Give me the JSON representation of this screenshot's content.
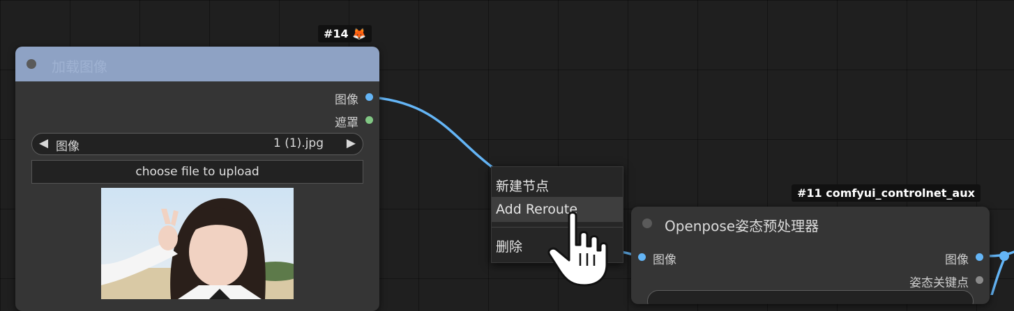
{
  "load_image_node": {
    "badge": "#14 🦊",
    "title": "加载图像",
    "outputs": {
      "image": "图像",
      "mask": "遮罩"
    },
    "image_combo": {
      "label": "图像",
      "value": "1 (1).jpg",
      "prev_arrow": "◀",
      "next_arrow": "▶"
    },
    "upload_label": "choose file to upload",
    "colors": {
      "header": "#8ea2c4",
      "image_dot": "#64b5f6",
      "mask_dot": "#81c784"
    }
  },
  "context_menu": {
    "items": [
      "新建节点",
      "Add Reroute",
      "删除"
    ],
    "hovered_item": "Add Reroute"
  },
  "openpose_node": {
    "badge": "#11 comfyui_controlnet_aux",
    "title": "Openpose姿态预处理器",
    "inputs": {
      "image": "图像"
    },
    "outputs": {
      "image": "图像",
      "pose_keypoint": "姿态关键点"
    }
  },
  "colors": {
    "canvas_bg": "#1f1f1f",
    "node_bg": "#353535",
    "link": "#64b5f6"
  }
}
